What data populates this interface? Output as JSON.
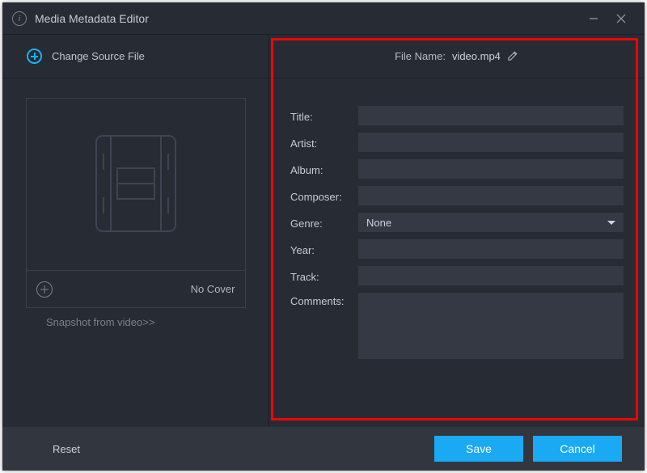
{
  "window": {
    "title": "Media Metadata Editor"
  },
  "actions": {
    "change_source": "Change Source File",
    "no_cover": "No Cover",
    "snapshot_link": "Snapshot from video>>",
    "reset": "Reset",
    "save": "Save",
    "cancel": "Cancel"
  },
  "file": {
    "label": "File Name:",
    "name": "video.mp4"
  },
  "form": {
    "title": {
      "label": "Title:",
      "value": ""
    },
    "artist": {
      "label": "Artist:",
      "value": ""
    },
    "album": {
      "label": "Album:",
      "value": ""
    },
    "composer": {
      "label": "Composer:",
      "value": ""
    },
    "genre": {
      "label": "Genre:",
      "value": "None"
    },
    "year": {
      "label": "Year:",
      "value": ""
    },
    "track": {
      "label": "Track:",
      "value": ""
    },
    "comments": {
      "label": "Comments:",
      "value": ""
    }
  },
  "colors": {
    "accent": "#1aa9f3",
    "highlight": "#ff0000"
  }
}
